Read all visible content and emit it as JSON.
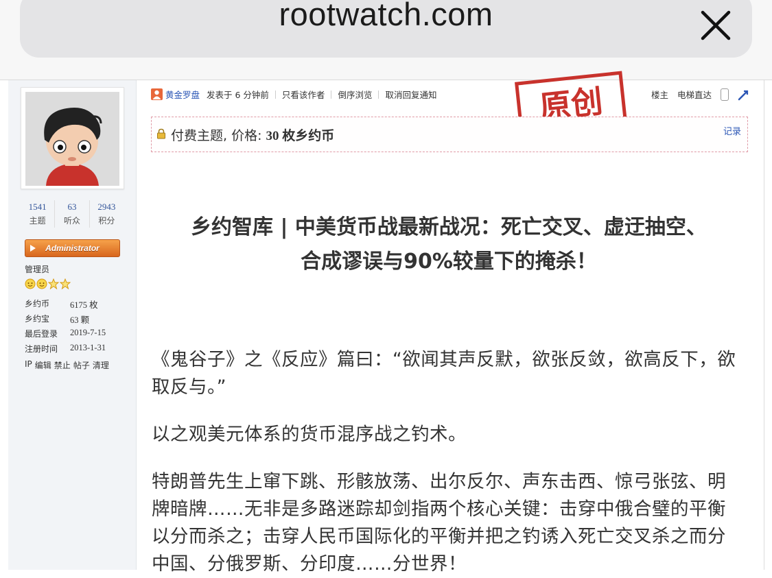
{
  "browser": {
    "url": "rootwatch.com",
    "close_icon": "close-icon"
  },
  "profile": {
    "stats": [
      {
        "num": "1541",
        "label": "主题"
      },
      {
        "num": "63",
        "label": "听众"
      },
      {
        "num": "2943",
        "label": "积分"
      }
    ],
    "badge": "Administrator",
    "role": "管理员",
    "fields": [
      {
        "k": "乡约币",
        "v": "6175 枚"
      },
      {
        "k": "乡约宝",
        "v": "63 颗"
      },
      {
        "k": "最后登录",
        "v": "2019-7-15"
      },
      {
        "k": "注册时间",
        "v": "2013-1-31"
      }
    ],
    "admin_links": [
      "IP",
      "编辑",
      "禁止",
      "帖子",
      "清理"
    ]
  },
  "post_header": {
    "author": "黄金罗盘",
    "posted": "发表于 6 分钟前",
    "links": [
      "只看该作者",
      "倒序浏览",
      "取消回复通知"
    ],
    "stamp": "原创",
    "right_links": [
      "楼主",
      "电梯直达"
    ]
  },
  "paid": {
    "label": "付费主题, 价格: ",
    "price": "30 枚乡约币",
    "record": "记录"
  },
  "article": {
    "title_line1": "乡约智库 | 中美货币战最新战况：死亡交叉、虚迂抽空、",
    "title_line2": "合成谬误与90%较量下的掩杀！",
    "paragraphs": [
      [
        "《鬼谷子》之《反应》篇曰：“欲闻其声反默，欲张反敛，欲高反下，欲",
        "取反与。”"
      ],
      [
        "以之观美元体系的货币混序战之钓术。"
      ],
      [
        "特朗普先生上窜下跳、形骸放荡、出尔反尔、声东击西、惊弓张弦、明",
        "牌暗牌……无非是多路迷踪却剑指两个核心关键：击穿中俄合璧的平衡",
        "以分而杀之；击穿人民币国际化的平衡并把之钓诱入死亡交叉杀之而分",
        "中国、分俄罗斯、分印度……分世界！"
      ]
    ]
  }
}
